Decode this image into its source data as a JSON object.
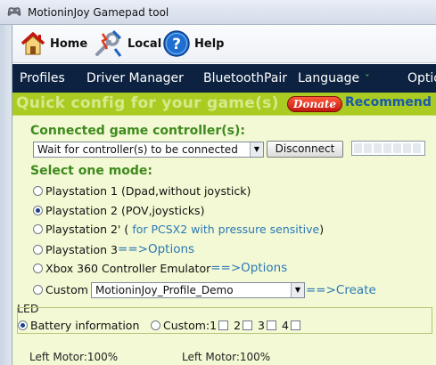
{
  "window": {
    "title": "MotioninJoy Gamepad tool"
  },
  "toolbar": {
    "items": [
      {
        "label": "Home",
        "icon": "home-icon"
      },
      {
        "label": "Local",
        "icon": "wrench-plug-icon"
      },
      {
        "label": "Help",
        "icon": "help-icon"
      }
    ]
  },
  "menu": {
    "items": [
      "Profiles",
      "Driver Manager",
      "BluetoothPair",
      "Language",
      "Optio"
    ],
    "language_caret": "ˇ"
  },
  "banner": {
    "title": "Quick config for your game(s)",
    "donate_label": "Donate",
    "recommend_label": "Recommend f"
  },
  "controllers": {
    "heading": "Connected game controller(s):",
    "select_value": "Wait for controller(s) to be connected",
    "disconnect_label": "Disconnect"
  },
  "modes": {
    "heading": "Select one mode:",
    "selected_index": 1,
    "options": [
      {
        "label": "Playstation 1 (Dpad,without joystick)",
        "hint": ""
      },
      {
        "label": "Playstation 2 (POV,joysticks)",
        "hint": ""
      },
      {
        "label": "Playstation 2' (",
        "hint": "for PCSX2 with pressure sensitive",
        "suffix": ")"
      },
      {
        "label": "Playstation 3",
        "link": "==>Options"
      },
      {
        "label": "Xbox 360 Controller Emulator",
        "link": "==>Options"
      },
      {
        "label": "Custom",
        "select_value": "MotioninJoy_Profile_Demo",
        "link": "==>Create"
      }
    ]
  },
  "led": {
    "heading": "LED",
    "battery_label": "Battery information",
    "custom_label": "Custom:",
    "slots": [
      "1",
      "2",
      "3",
      "4"
    ],
    "battery_selected": true
  },
  "motors": {
    "left_label": "Left Motor:",
    "left_value": "100%",
    "right_label": "Left Motor:",
    "right_value": "100%"
  },
  "colors": {
    "menubar": "#0c2240",
    "banner": "#aacc22",
    "panel": "#f3f9d4",
    "heading": "#3e8a1e",
    "link": "#2a78b5"
  }
}
